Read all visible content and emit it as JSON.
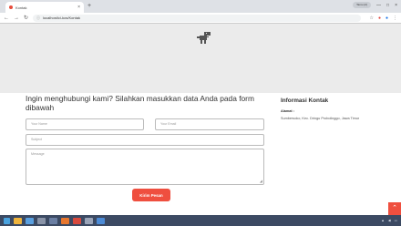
{
  "browser": {
    "tab_title": "Kontak",
    "address": "localhost/ci-kos/Kontak",
    "profile_label": "Tamu (2)"
  },
  "page": {
    "heading": "Ingin menghubungi kami? Silahkan masukkan data Anda pada form dibawah",
    "form": {
      "name_placeholder": "Your Name",
      "email_placeholder": "Your Email",
      "subject_placeholder": "Subject",
      "message_placeholder": "Message",
      "submit_label": "Kirim Pesan"
    },
    "info": {
      "title": "Informasi Kontak",
      "address_label": "Alamat :",
      "address_text": "Sumbersoko, Kec. Dringu Probolinggo, Jawa Timur"
    }
  },
  "colors": {
    "accent": "#ef4f3f",
    "banner": "#ebebeb",
    "taskbar": "#3c4a63"
  },
  "icons": [
    "back-arrow-icon",
    "forward-arrow-icon",
    "reload-icon",
    "lock-icon",
    "star-icon",
    "dinosaur-icon",
    "chevron-up-icon",
    "windows-start-icon"
  ]
}
